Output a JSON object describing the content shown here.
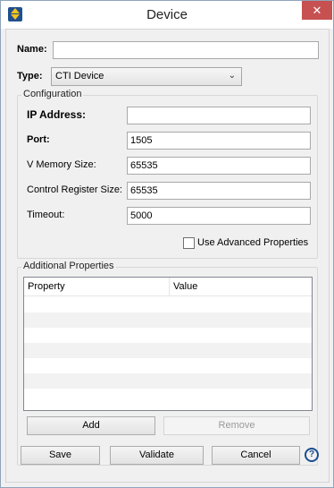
{
  "window": {
    "title": "Device"
  },
  "form": {
    "name_label": "Name:",
    "name_value": "",
    "type_label": "Type:",
    "type_value": "CTI Device"
  },
  "configuration": {
    "title": "Configuration",
    "fields": [
      {
        "label": "IP Address:",
        "value": ""
      },
      {
        "label": "Port:",
        "value": "1505"
      },
      {
        "label": "V Memory Size:",
        "value": "65535"
      },
      {
        "label": "Control Register Size:",
        "value": "65535"
      },
      {
        "label": "Timeout:",
        "value": "5000"
      }
    ],
    "advanced_label": "Use Advanced Properties"
  },
  "additional": {
    "title": "Additional Properties",
    "columns": [
      "Property",
      "Value"
    ],
    "add_label": "Add",
    "remove_label": "Remove"
  },
  "buttons": {
    "save": "Save",
    "validate": "Validate",
    "cancel": "Cancel",
    "help": "?"
  },
  "icons": {
    "close": "close-icon",
    "app": "app-icon",
    "dropdown": "chevron-down-icon",
    "help": "help-icon"
  }
}
